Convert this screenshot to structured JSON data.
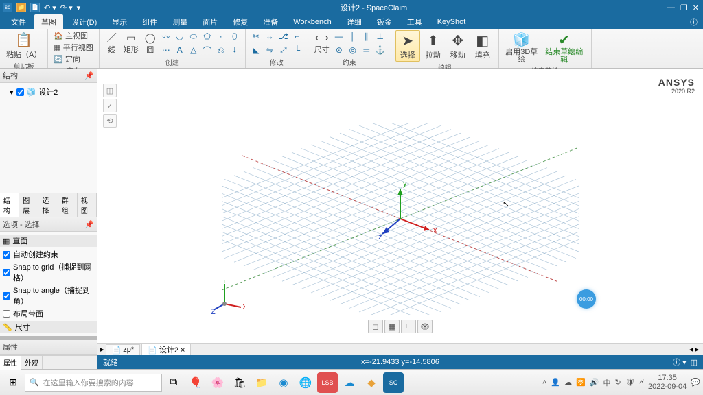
{
  "title": "设计2 - SpaceClaim",
  "menu": {
    "file": "文件",
    "sketch": "草图",
    "design": "设计(D)",
    "display": "显示",
    "assemble": "组件",
    "measure": "测量",
    "patch": "面片",
    "prepare": "修复",
    "setup": "准备",
    "workbench": "Workbench",
    "detailed": "详细",
    "sheet": "钣金",
    "tools": "工具",
    "keyshot": "KeyShot"
  },
  "ribbon": {
    "clipboard": {
      "paste": "粘贴（A）",
      "label": "剪贴板"
    },
    "orient": {
      "home": "主视图",
      "plan": "平行视图",
      "orient": "定向",
      "label": "定向"
    },
    "create": {
      "line": "线",
      "rect": "矩形",
      "circle": "圆",
      "label": "创建"
    },
    "modify": {
      "label": "修改"
    },
    "constraint": {
      "dim": "尺寸",
      "label": "约束"
    },
    "edit": {
      "select": "选择",
      "pull": "拉动",
      "move": "移动",
      "fill": "填充",
      "label": "编辑"
    },
    "mode": {
      "enable3d": "启用3D草绘"
    },
    "end": {
      "end": "结束草绘编辑",
      "label": "结束草绘"
    }
  },
  "tree": {
    "header": "结构",
    "root": "设计2"
  },
  "sidetabs": {
    "structure": "结构",
    "layers": "图层",
    "select": "选择",
    "groups": "群组",
    "views": "视图"
  },
  "options": {
    "header": "选项 - 选择",
    "cartesian": "直面",
    "autoconstraint": "自动创建约束",
    "snapgrid": "Snap to grid（捕捉到网格）",
    "snapangle": "Snap to angle（捕捉到角）",
    "layout": "布局带面",
    "dim": "尺寸"
  },
  "props": {
    "header": "属性",
    "t1": "属性",
    "t2": "外观"
  },
  "ansys": {
    "brand": "ANSYS",
    "ver": "2020 R2"
  },
  "timer": "00:00",
  "docs": {
    "d1": "zp*",
    "d2": "设计2 ×"
  },
  "status": {
    "ready": "就绪",
    "coords": "x=-21.9433  y=-14.5806"
  },
  "taskbar": {
    "search_placeholder": "在这里输入你要搜索的内容",
    "time": "17:35",
    "date": "2022-09-04"
  },
  "chart_data": {
    "type": "other",
    "note": "3D sketch plane with XYZ triad at origin; no numeric data series."
  }
}
